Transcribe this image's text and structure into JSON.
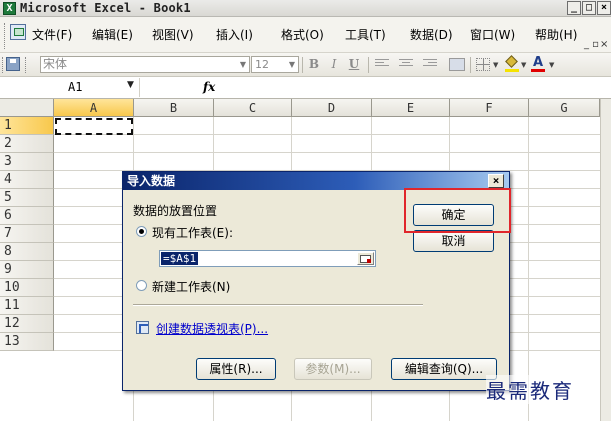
{
  "window": {
    "title": "Microsoft Excel - Book1",
    "app_icon": "X",
    "min_glyph": "_",
    "max_glyph": "□",
    "close_glyph": "×"
  },
  "menubar": {
    "items": [
      "文件(F)",
      "编辑(E)",
      "视图(V)",
      "插入(I)",
      "格式(O)",
      "工具(T)",
      "数据(D)",
      "窗口(W)",
      "帮助(H)"
    ],
    "restore_glyph": "_ ▫",
    "close_glyph": "×"
  },
  "toolbar": {
    "font_name": "宋体",
    "font_size": "12",
    "bold": "B",
    "italic": "I",
    "underline": "U",
    "font_color_glyph": "A",
    "fill_color": "#f5e300",
    "font_color": "#e00000"
  },
  "formula_bar": {
    "name_box": "A1",
    "fx_label": "fx",
    "content": ""
  },
  "grid": {
    "columns": [
      "A",
      "B",
      "C",
      "D",
      "E",
      "F",
      "G"
    ],
    "rows": [
      "1",
      "2",
      "3",
      "4",
      "5",
      "6",
      "7",
      "8",
      "9",
      "10",
      "11",
      "12",
      "13"
    ],
    "active_cell": "A1"
  },
  "dialog": {
    "title": "导入数据",
    "close_glyph": "×",
    "placement_label": "数据的放置位置",
    "existing_sheet_label": "现有工作表(E):",
    "existing_sheet_selected": true,
    "reference_value": "=$A$1",
    "new_sheet_label": "新建工作表(N)",
    "new_sheet_selected": false,
    "pivot_link": "创建数据透视表(P)...",
    "ok_label": "确定",
    "cancel_label": "取消",
    "properties_label": "属性(R)...",
    "parameters_label": "参数(M)...",
    "edit_query_label": "编辑查询(Q)..."
  },
  "watermark": "最需教育",
  "colors": {
    "dialog_title_start": "#0a246a",
    "highlight": "#e0262b",
    "link": "#0000cc"
  }
}
